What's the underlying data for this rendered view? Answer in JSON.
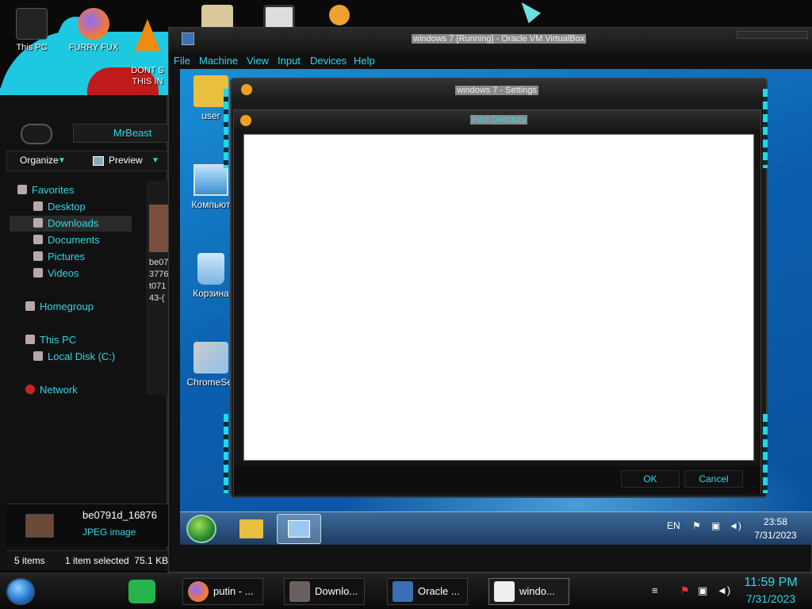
{
  "host_desktop": {
    "icons": [
      {
        "label": "This PC",
        "icon": "computer-icon"
      },
      {
        "label": "FURRY FUX",
        "icon": "firefox-icon"
      },
      {
        "label": "DONT S\nTHIS IN",
        "icon": "vlc-cone-icon"
      },
      {
        "label": "",
        "icon": "app-icon"
      },
      {
        "label": "",
        "icon": "app-icon"
      },
      {
        "label": "",
        "icon": "user-icon"
      }
    ]
  },
  "explorer": {
    "breadcrumb": "MrBeast",
    "toolbar": {
      "organize": "Organize",
      "preview": "Preview"
    },
    "nav": {
      "favorites": "Favorites",
      "desktop": "Desktop",
      "downloads": "Downloads",
      "documents": "Documents",
      "pictures": "Pictures",
      "videos": "Videos",
      "homegroup": "Homegroup",
      "this_pc": "This PC",
      "local_disk": "Local Disk (C:)",
      "network": "Network"
    },
    "content_filename_lines": [
      "be07",
      "3776",
      "t071",
      "43-("
    ],
    "details": {
      "filename": "be0791d_16876",
      "filetype": "JPEG image"
    },
    "status": {
      "items": "5 items",
      "selected": "1 item selected  75.1 KB"
    }
  },
  "vbox": {
    "title": "windows 7 [Running] - Oracle VM VirtualBox",
    "menu": [
      "File",
      "Machine",
      "View",
      "Input",
      "Devices",
      "Help"
    ]
  },
  "guest": {
    "icons": [
      {
        "label": "user",
        "icon": "folder-user-icon"
      },
      {
        "label": "Компьют",
        "icon": "computer-icon"
      },
      {
        "label": "Корзина",
        "icon": "recycle-bin-icon"
      },
      {
        "label": "ChromeSet",
        "icon": "installer-icon"
      }
    ],
    "taskbar": {
      "lang": "EN",
      "time": "23:58",
      "date": "7/31/2023"
    }
  },
  "settings_dialog": {
    "title": "windows 7 - Settings"
  },
  "find_directory_dialog": {
    "title": "Find Directory",
    "ok": "OK",
    "cancel": "Cancel"
  },
  "host_taskbar": {
    "tasks": [
      {
        "label": "putin - ...",
        "icon": "firefox-icon"
      },
      {
        "label": "Downlo...",
        "icon": "explorer-icon"
      },
      {
        "label": "Oracle ...",
        "icon": "virtualbox-icon"
      },
      {
        "label": "windo...",
        "icon": "windows7-vm-icon"
      }
    ],
    "time": "11:59 PM",
    "date": "7/31/2023"
  },
  "colors": {
    "accent": "#2fd6e6",
    "guest_blue": "#0b5fae"
  }
}
